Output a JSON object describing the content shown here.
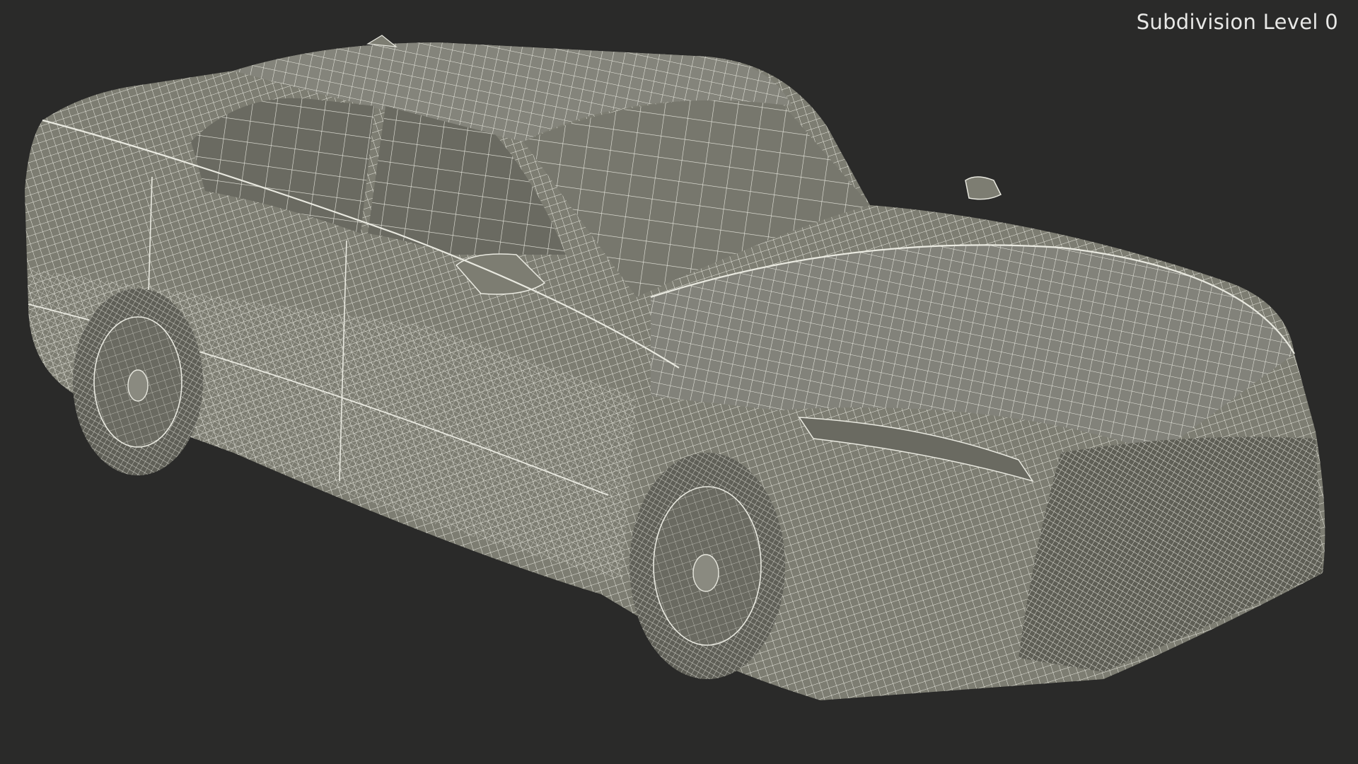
{
  "viewport": {
    "subdivision_label": "Subdivision Level 0"
  },
  "scene": {
    "background_color": "#2a2a29",
    "surface_color": "#7d7d72",
    "wire_color": "#e9e9e0",
    "shadow_color": "#5e5e55"
  }
}
